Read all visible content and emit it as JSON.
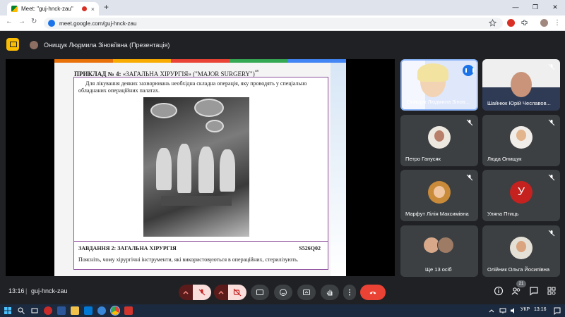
{
  "browser": {
    "tab_title": "Meet: \"guj-hnck-zau\"",
    "tab_close": "×",
    "new_tab": "+",
    "url": "meet.google.com/guj-hnck-zau",
    "window_controls": [
      "—",
      "❐",
      "✕"
    ]
  },
  "meet": {
    "presenter_label": "Онищук Людмила Зіновіївна (Презентація)",
    "meeting_code": "guj-hnck-zau",
    "time": "13:16",
    "separator": "|",
    "participant_count": "21",
    "accent_color": "#1a73e8",
    "leave_color": "#ea4335"
  },
  "slide": {
    "title_prefix": "ПРИКЛАД № 4:",
    "title_rest": " «ЗАГАЛЬНА ХІРУРГІЯ» (\"MAJOR SURGERY\")",
    "title_sup": "⁴⁸",
    "intro": "Для лікування деяких захворювань необхідна складна операція, яку проводять у спеціально обладнаних операційних палатах.",
    "task_title": "ЗАВДАННЯ 2: ЗАГАЛЬНА ХІРУРГІЯ",
    "task_code": "S526Q02",
    "task_question": "Поясніть, чому хірургічні інструменти, які використовуються в операційних, стерилізують."
  },
  "participants": [
    {
      "name": "Онищук Людмила Зінов...",
      "mic_muted": false,
      "type": "video"
    },
    {
      "name": "Шайнюк Юрій Чеславов...",
      "mic_muted": true,
      "type": "video"
    },
    {
      "name": "Петро Ганусяк",
      "mic_muted": true,
      "type": "avatar"
    },
    {
      "name": "Люда Онищук",
      "mic_muted": true,
      "type": "avatar"
    },
    {
      "name": "Марфут Лілія Максимівна",
      "mic_muted": true,
      "type": "avatar"
    },
    {
      "name": "Уляна Птиць",
      "mic_muted": true,
      "type": "letter",
      "letter": "У",
      "color": "#c5221f"
    },
    {
      "name": "Ще 13 осіб",
      "mic_muted": false,
      "type": "group"
    },
    {
      "name": "Олійник Ольга Йосипівна",
      "mic_muted": true,
      "type": "avatar"
    }
  ],
  "taskbar": {
    "lang": "УКР",
    "time": "13:16"
  }
}
